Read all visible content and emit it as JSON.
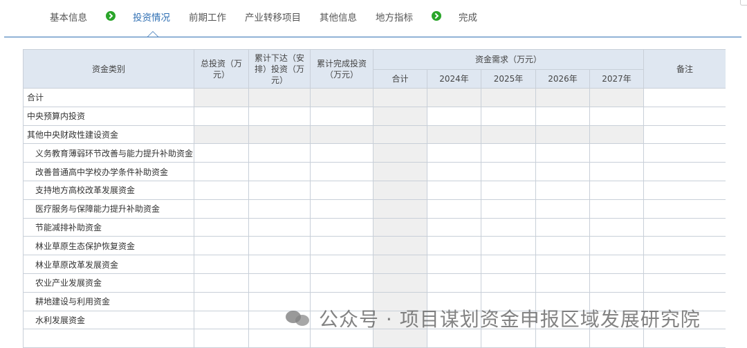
{
  "steps": [
    {
      "label": "基本信息",
      "completed": true,
      "active": false
    },
    {
      "label": "投资情况",
      "completed": false,
      "active": true
    },
    {
      "label": "前期工作",
      "completed": false,
      "active": false
    },
    {
      "label": "产业转移项目",
      "completed": false,
      "active": false
    },
    {
      "label": "其他信息",
      "completed": false,
      "active": false
    },
    {
      "label": "地方指标",
      "completed": true,
      "active": false
    },
    {
      "label": "完成",
      "completed": false,
      "active": false
    }
  ],
  "colors": {
    "accent": "#2f6fb3",
    "check": "#2aa52a",
    "header_bg": "#dfe7f1",
    "shaded_cell": "#efefef"
  },
  "table": {
    "headers": {
      "category": "资金类别",
      "total_investment": "总投资（万元）",
      "cumulative_issued": "累计下达（安排）投资（万元）",
      "cumulative_completed": "累计完成投资（万元）",
      "demand_group": "资金需求（万元）",
      "demand_total": "合计",
      "year_2024": "2024年",
      "year_2025": "2025年",
      "year_2026": "2026年",
      "year_2027": "2027年",
      "remarks": "备注"
    },
    "rows": [
      {
        "label": "合计",
        "indent": false
      },
      {
        "label": "中央预算内投资",
        "indent": false
      },
      {
        "label": "其他中央财政性建设资金",
        "indent": false
      },
      {
        "label": "义务教育薄弱环节改善与能力提升补助资金",
        "indent": true
      },
      {
        "label": "改善普通高中学校办学条件补助资金",
        "indent": true
      },
      {
        "label": "支持地方高校改革发展资金",
        "indent": true
      },
      {
        "label": "医疗服务与保障能力提升补助资金",
        "indent": true
      },
      {
        "label": "节能减排补助资金",
        "indent": true
      },
      {
        "label": "林业草原生态保护恢复资金",
        "indent": true
      },
      {
        "label": "林业草原改革发展资金",
        "indent": true
      },
      {
        "label": "农业产业发展资金",
        "indent": true
      },
      {
        "label": "耕地建设与利用资金",
        "indent": true
      },
      {
        "label": "水利发展资金",
        "indent": true
      },
      {
        "label": "",
        "indent": true
      }
    ]
  },
  "watermark": {
    "text": "公众号 · 项目谋划资金申报区域发展研究院",
    "icon": "wechat-icon"
  }
}
